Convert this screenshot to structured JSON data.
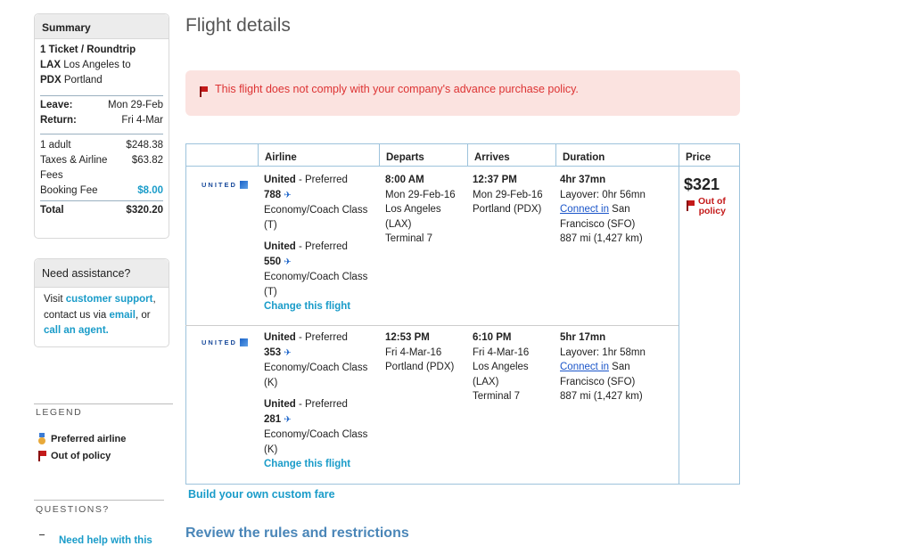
{
  "summary": {
    "title": "Summary",
    "ticket": "1 Ticket / Roundtrip",
    "from_code": "LAX",
    "from_city": "Los Angeles to",
    "to_code": "PDX",
    "to_city": "Portland",
    "leave_label": "Leave:",
    "leave_value": "Mon 29-Feb",
    "return_label": "Return:",
    "return_value": "Fri 4-Mar",
    "adult_label": "1 adult",
    "adult_value": "$248.38",
    "taxes_label": "Taxes & Airline Fees",
    "taxes_value": "$63.82",
    "booking_label": "Booking Fee",
    "booking_value": "$8.00",
    "total_label": "Total",
    "total_value": "$320.20"
  },
  "assist": {
    "title": "Need assistance?",
    "l1_pre": "Visit ",
    "l1_link": "customer support",
    "l1_post": ",",
    "l2_pre": "contact us via ",
    "l2_link": "email",
    "l2_post": ", or",
    "l3_link": "call an agent."
  },
  "legend": {
    "title": "LEGEND",
    "preferred": "Preferred airline",
    "out_of_policy": "Out of policy",
    "questions": "QUESTIONS?",
    "help_partial": "Need help with this"
  },
  "main": {
    "title": "Flight details",
    "alert": "This flight does not comply with your company's advance purchase policy.",
    "headers": [
      "Airline",
      "Departs",
      "Arrives",
      "Duration",
      "Price"
    ],
    "airline_logo": "UNITED",
    "outbound": {
      "seg1": {
        "airline": "United",
        "pref": " - Preferred",
        "flight": "788",
        "cabin": "Economy/Coach Class",
        "cls": "(T)"
      },
      "seg2": {
        "airline": "United",
        "pref": " - Preferred",
        "flight": "550",
        "cabin": "Economy/Coach Class",
        "cls": "(T)"
      },
      "change": "Change this flight",
      "dep_time": "8:00 AM",
      "dep_date": "Mon 29-Feb-16",
      "dep_city": "Los Angeles",
      "dep_code": "(LAX)",
      "dep_term": "Terminal 7",
      "arr_time": "12:37 PM",
      "arr_date": "Mon 29-Feb-16",
      "arr_city": "Portland (PDX)",
      "duration": "4hr 37mn",
      "layover": "Layover: 0hr 56mn",
      "connect_link": "Connect in",
      "connect_city": " San",
      "connect_city2": "Francisco (SFO)",
      "distance": "887 mi (1,427 km)",
      "price": "$321",
      "oop1": "Out of",
      "oop2": "policy"
    },
    "inbound": {
      "seg1": {
        "airline": "United",
        "pref": " - Preferred",
        "flight": "353",
        "cabin": "Economy/Coach Class",
        "cls": "(K)"
      },
      "seg2": {
        "airline": "United",
        "pref": " - Preferred",
        "flight": "281",
        "cabin": "Economy/Coach Class",
        "cls": "(K)"
      },
      "change": "Change this flight",
      "dep_time": "12:53 PM",
      "dep_date": "Fri 4-Mar-16",
      "dep_city": "Portland (PDX)",
      "arr_time": "6:10 PM",
      "arr_date": "Fri 4-Mar-16",
      "arr_city": "Los Angeles",
      "arr_code": "(LAX)",
      "arr_term": "Terminal 7",
      "duration": "5hr 17mn",
      "layover": "Layover: 1hr 58mn",
      "connect_link": "Connect in",
      "connect_city": " San",
      "connect_city2": "Francisco (SFO)",
      "distance": "887 mi (1,427 km)"
    },
    "custom_fare": "Build your own custom fare",
    "review": "Review the rules and restrictions"
  }
}
